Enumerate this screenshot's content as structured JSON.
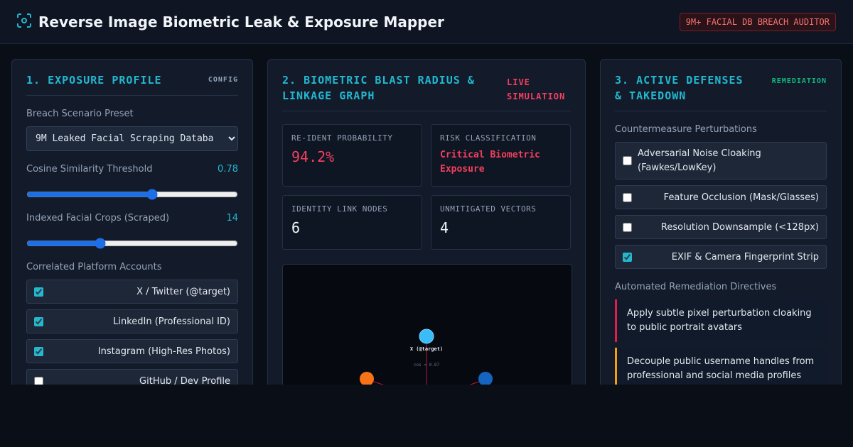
{
  "header": {
    "title": "Reverse Image Biometric Leak & Exposure Mapper",
    "badge": "9M+ FACIAL DB BREACH AUDITOR"
  },
  "exposure": {
    "title": "1. EXPOSURE PROFILE",
    "tag": "CONFIG",
    "preset_label": "Breach Scenario Preset",
    "preset_value": "9M Leaked Facial Scraping Databa",
    "similarity_label": "Cosine Similarity Threshold",
    "similarity_value": "0.78",
    "similarity_fraction": 0.6,
    "crops_label": "Indexed Facial Crops (Scraped)",
    "crops_value": "14",
    "crops_fraction": 0.34,
    "accounts_label": "Correlated Platform Accounts",
    "accounts": [
      {
        "label": "X / Twitter (@target)",
        "checked": true
      },
      {
        "label": "LinkedIn (Professional ID)",
        "checked": true
      },
      {
        "label": "Instagram (High-Res Photos)",
        "checked": true
      },
      {
        "label": "GitHub / Dev Profile",
        "checked": false
      }
    ]
  },
  "blast": {
    "title": "2. BIOMETRIC BLAST RADIUS & LINKAGE GRAPH",
    "tag": "LIVE SIMULATION",
    "stats": {
      "reident_label": "RE-IDENT PROBABILITY",
      "reident_value": "94.2%",
      "risk_label": "RISK CLASSIFICATION",
      "risk_value": "Critical Biometric Exposure",
      "nodes_label": "IDENTITY LINK NODES",
      "nodes_value": "6",
      "vectors_label": "UNMITIGATED VECTORS",
      "vectors_value": "4"
    },
    "graph": {
      "node_label": "X (@target)",
      "edge_label": "cos ≈ 0.87",
      "colors": {
        "node_main": "#38bdf8",
        "node_left": "#f97316",
        "node_right": "#1565c0",
        "edge": "#e11d48"
      }
    }
  },
  "defenses": {
    "title": "3. ACTIVE DEFENSES & TAKEDOWN",
    "tag": "REMEDIATION",
    "countermeasures_label": "Countermeasure Perturbations",
    "countermeasures": [
      {
        "label": "Adversarial Noise Cloaking (Fawkes/LowKey)",
        "checked": false
      },
      {
        "label": "Feature Occlusion (Mask/Glasses)",
        "checked": false
      },
      {
        "label": "Resolution Downsample (<128px)",
        "checked": false
      },
      {
        "label": "EXIF & Camera Fingerprint Strip",
        "checked": true
      }
    ],
    "directives_label": "Automated Remediation Directives",
    "directives": [
      {
        "text": "Apply subtle pixel perturbation cloaking to public portrait avatars"
      },
      {
        "text": "Decouple public username handles from professional and social media profiles"
      }
    ]
  },
  "colors": {
    "accent": "#22b8cf",
    "danger": "#f43f5e",
    "success": "#10b981"
  }
}
